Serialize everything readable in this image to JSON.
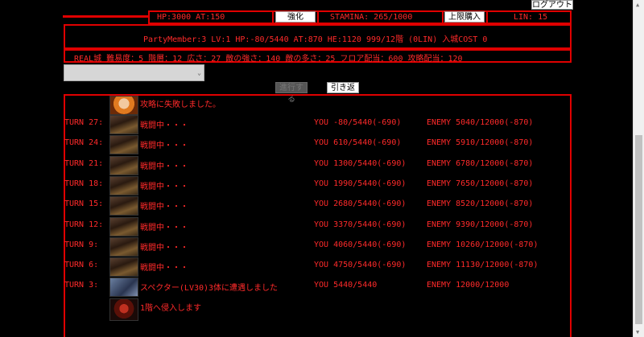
{
  "topbar": {
    "logout_label": "ログアウト"
  },
  "status": {
    "hp_at": "HP:3000 AT:150",
    "enhance_label": "強化",
    "stamina": "STAMINA: 265/1000",
    "buy_limit_label": "上限購入",
    "lin": "LIN: 15"
  },
  "party": {
    "info": "PartyMember:3  LV:1  HP:-80/5440  AT:870  HE:1120 999/12階  (0LIN)  入城COST 0"
  },
  "dungeon": {
    "info": "REAL城   難易度：5  階層：12  広さ：27  敵の強さ：140  敵の多さ：25  フロア配当：600  攻略配当：120"
  },
  "controls": {
    "select_value": "",
    "proceed_label": "進行する",
    "retreat_label": "引き返す"
  },
  "log": {
    "header_msg": "攻略に失敗しました。",
    "rows": [
      {
        "turn": "TURN 27:",
        "msg": "戦闘中・・・",
        "you": "YOU -80/5440(-690)",
        "enemy": "ENEMY 5040/12000(-870)"
      },
      {
        "turn": "TURN 24:",
        "msg": "戦闘中・・・",
        "you": "YOU 610/5440(-690)",
        "enemy": "ENEMY 5910/12000(-870)"
      },
      {
        "turn": "TURN 21:",
        "msg": "戦闘中・・・",
        "you": "YOU 1300/5440(-690)",
        "enemy": "ENEMY 6780/12000(-870)"
      },
      {
        "turn": "TURN 18:",
        "msg": "戦闘中・・・",
        "you": "YOU 1990/5440(-690)",
        "enemy": "ENEMY 7650/12000(-870)"
      },
      {
        "turn": "TURN 15:",
        "msg": "戦闘中・・・",
        "you": "YOU 2680/5440(-690)",
        "enemy": "ENEMY 8520/12000(-870)"
      },
      {
        "turn": "TURN 12:",
        "msg": "戦闘中・・・",
        "you": "YOU 3370/5440(-690)",
        "enemy": "ENEMY 9390/12000(-870)"
      },
      {
        "turn": "TURN 9:",
        "msg": "戦闘中・・・",
        "you": "YOU 4060/5440(-690)",
        "enemy": "ENEMY 10260/12000(-870)"
      },
      {
        "turn": "TURN 6:",
        "msg": "戦闘中・・・",
        "you": "YOU 4750/5440(-690)",
        "enemy": "ENEMY 11130/12000(-870)"
      },
      {
        "turn": "TURN 3:",
        "msg": "スペクター(LV30)3体に遭遇しました",
        "you": "YOU 5440/5440",
        "enemy": "ENEMY 12000/12000"
      }
    ],
    "footer_msg": "1階へ侵入します"
  },
  "colors": {
    "accent": "#e00000",
    "text": "#ff2a2a",
    "background": "#000000"
  }
}
